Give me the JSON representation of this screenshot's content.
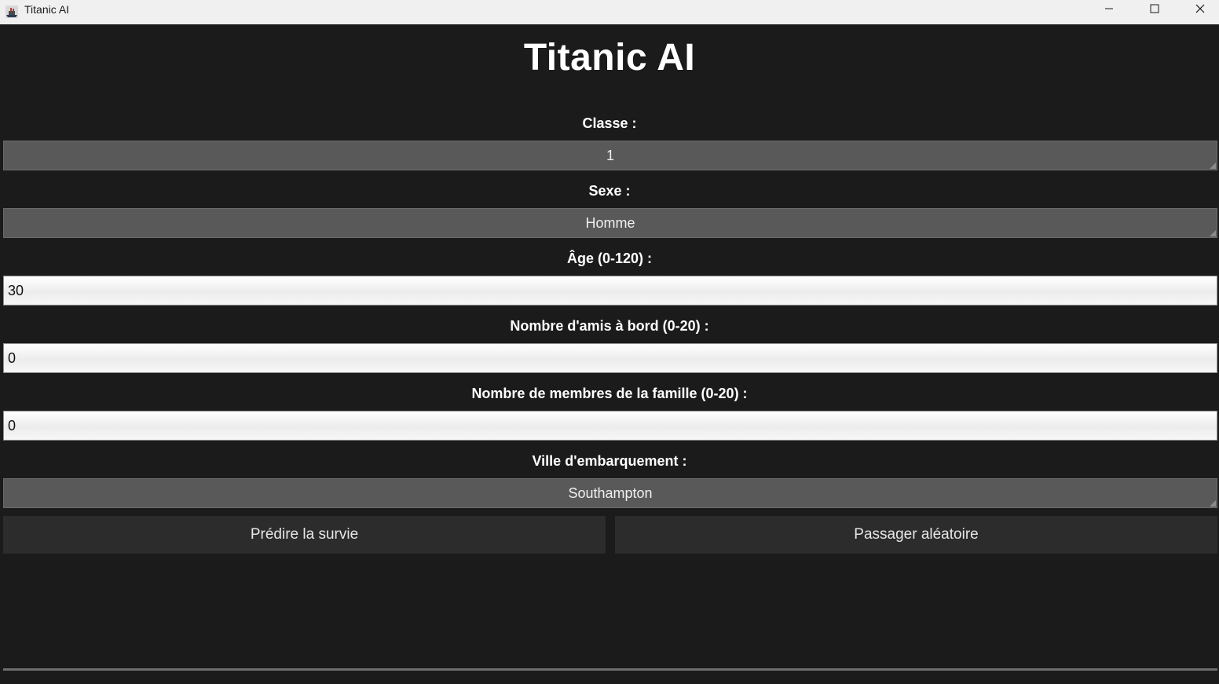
{
  "window": {
    "title": "Titanic AI",
    "icon": "titanic-app-icon",
    "controls": [
      "minimize-icon",
      "maximize-icon",
      "close-icon"
    ]
  },
  "main": {
    "heading": "Titanic AI",
    "fields": {
      "classe": {
        "label": "Classe :",
        "value": "1"
      },
      "sexe": {
        "label": "Sexe :",
        "value": "Homme"
      },
      "age": {
        "label": "Âge (0-120) :",
        "value": "30"
      },
      "amis": {
        "label": "Nombre d'amis à bord (0-20) :",
        "value": "0"
      },
      "famille": {
        "label": "Nombre de membres de la famille (0-20) :",
        "value": "0"
      },
      "ville": {
        "label": "Ville d'embarquement :",
        "value": "Southampton"
      }
    },
    "buttons": {
      "predict": "Prédire la survie",
      "random": "Passager aléatoire"
    }
  },
  "colors": {
    "background": "#1b1b1b",
    "titlebar": "#f0f0f0",
    "select": "#595959",
    "button": "#2c2c2c",
    "text": "#ffffff"
  }
}
